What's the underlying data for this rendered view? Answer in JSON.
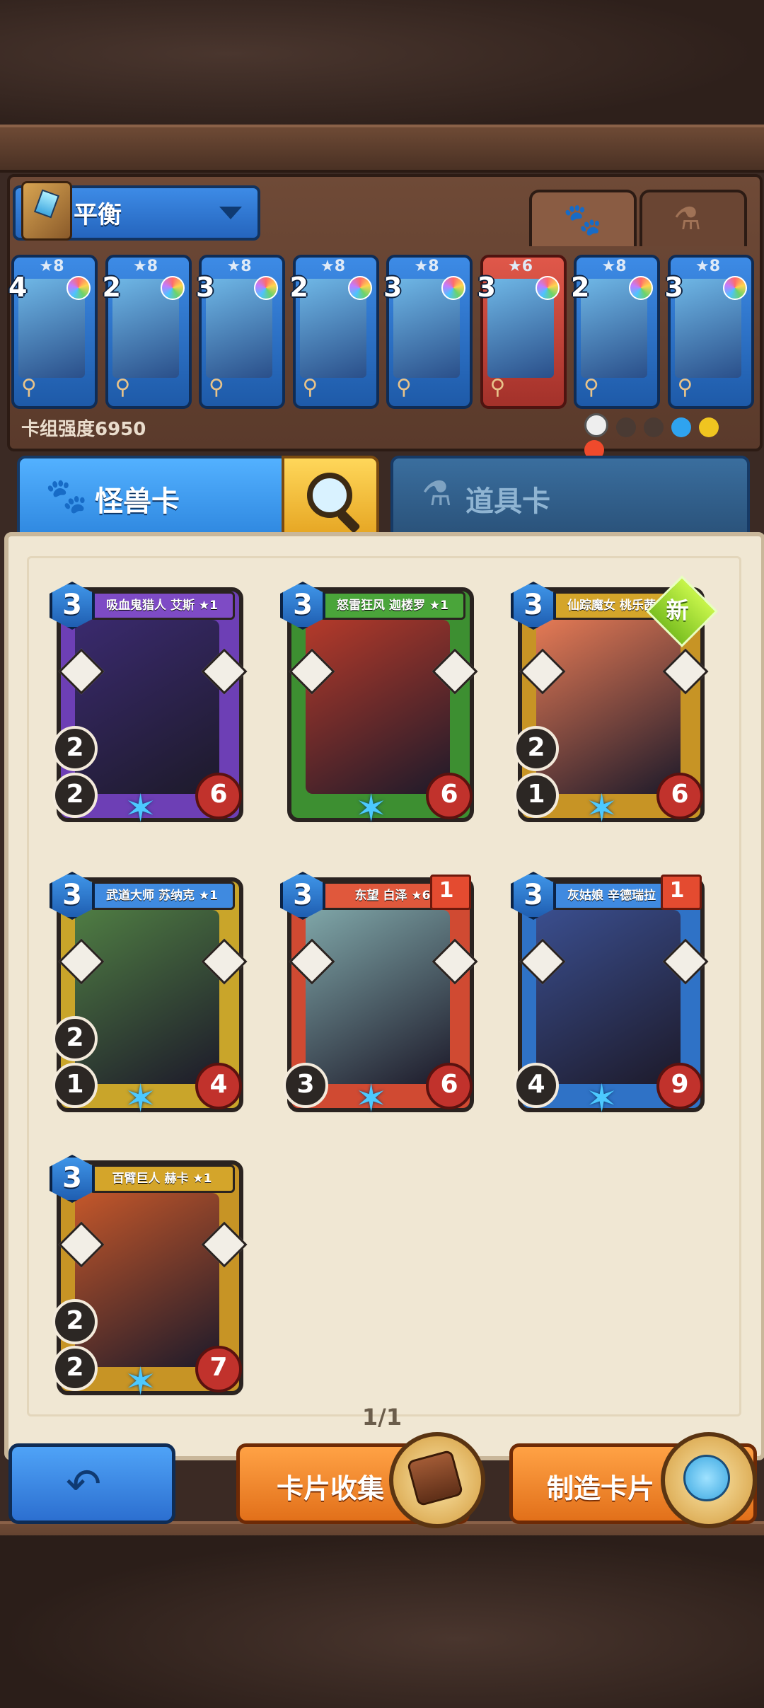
{
  "deck": {
    "mode_label": "平衡",
    "power_label": "卡组强度6950",
    "cards": [
      {
        "stars": "★8",
        "cost": "4",
        "color": "blue"
      },
      {
        "stars": "★8",
        "cost": "2",
        "color": "blue"
      },
      {
        "stars": "★8",
        "cost": "3",
        "color": "blue"
      },
      {
        "stars": "★8",
        "cost": "2",
        "color": "blue"
      },
      {
        "stars": "★8",
        "cost": "3",
        "color": "blue"
      },
      {
        "stars": "★6",
        "cost": "3",
        "color": "red"
      },
      {
        "stars": "★8",
        "cost": "2",
        "color": "blue"
      },
      {
        "stars": "★8",
        "cost": "3",
        "color": "blue"
      }
    ]
  },
  "tabs": {
    "monster_tab_icon": "paw-icon",
    "potion_tab_icon": "potion-icon"
  },
  "category": {
    "monster_label": "怪兽卡",
    "item_label": "道具卡"
  },
  "cards": [
    {
      "name": "吸血鬼猎人 艾斯 ★1",
      "cost": "3",
      "atk": "2",
      "def": "2",
      "hp": "6",
      "banner": "#7e4bc5",
      "frame": "#6d3fb5",
      "art": "#3a2a6e"
    },
    {
      "name": "怒雷狂风 迦楼罗 ★1",
      "cost": "3",
      "atk": "",
      "def": "",
      "hp": "6",
      "banner": "#4aa53a",
      "frame": "#3d8f31",
      "art": "#b53a2a"
    },
    {
      "name": "仙踪魔女 桃乐茜 ★1",
      "cost": "3",
      "atk": "2",
      "def": "1",
      "hp": "6",
      "banner": "#d4a52a",
      "frame": "#c79425",
      "art": "#e57a55",
      "new": "新"
    },
    {
      "name": "武道大师 苏纳克 ★1",
      "cost": "3",
      "atk": "2",
      "def": "1",
      "hp": "4",
      "banner": "#3f8ae0",
      "frame": "#c9a52a",
      "art": "#4f7d43"
    },
    {
      "name": "东望 白泽 ★6",
      "cost": "3",
      "atk": "",
      "def": "3",
      "hp": "6",
      "banner": "#e0583c",
      "frame": "#d04a32",
      "art": "#7fa6a8",
      "count": "1"
    },
    {
      "name": "灰姑娘 辛德瑞拉 ★8",
      "cost": "3",
      "atk": "",
      "def": "4",
      "hp": "9",
      "banner": "#3f8ae0",
      "frame": "#2f72c6",
      "art": "#3a4e8e",
      "count": "1"
    },
    {
      "name": "百臂巨人 赫卡 ★1",
      "cost": "3",
      "atk": "2",
      "def": "2",
      "hp": "7",
      "banner": "#d4a52a",
      "frame": "#c79425",
      "art": "#c4572a"
    }
  ],
  "page_indicator": "1/1",
  "buttons": {
    "back_icon": "back-arrow-icon",
    "collect_label": "卡片收集",
    "craft_label": "制造卡片"
  }
}
